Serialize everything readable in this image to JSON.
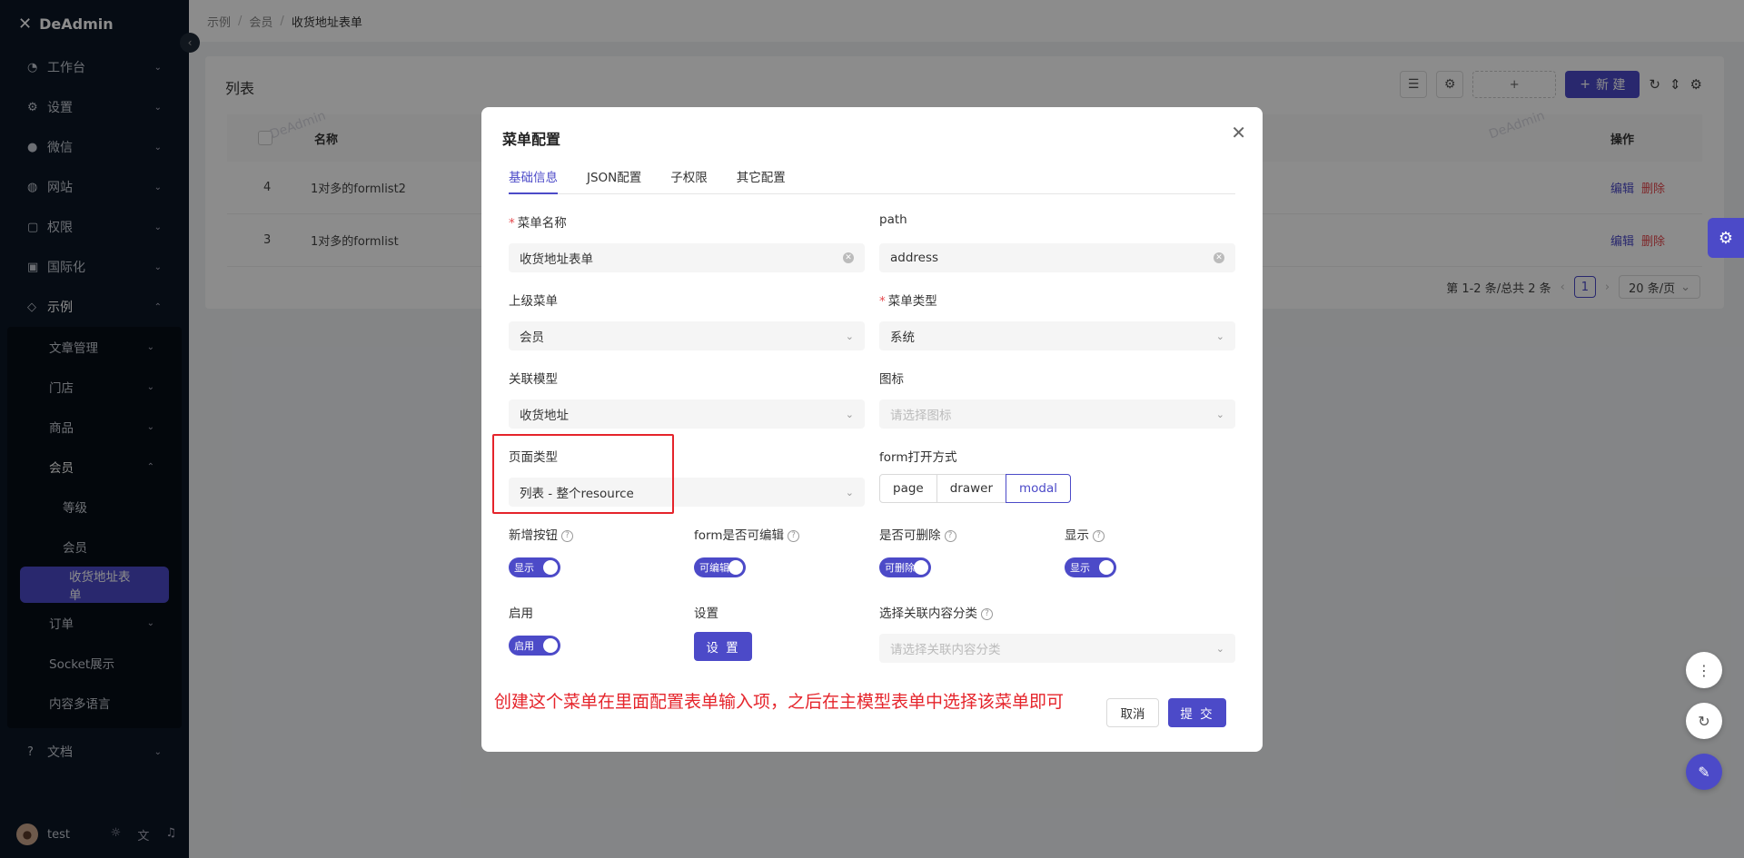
{
  "sidebar": {
    "brand": "DeAdmin",
    "items": [
      {
        "label": "工作台",
        "icon": "dashboard-icon"
      },
      {
        "label": "设置",
        "icon": "gear-icon"
      },
      {
        "label": "微信",
        "icon": "wechat-icon"
      },
      {
        "label": "网站",
        "icon": "globe-icon"
      },
      {
        "label": "权限",
        "icon": "lock-icon"
      },
      {
        "label": "国际化",
        "icon": "translate-icon"
      },
      {
        "label": "示例",
        "icon": "tag-icon"
      }
    ],
    "example_children": [
      {
        "label": "文章管理"
      },
      {
        "label": "门店"
      },
      {
        "label": "商品"
      },
      {
        "label": "会员"
      }
    ],
    "member_children": [
      {
        "label": "等级"
      },
      {
        "label": "会员"
      },
      {
        "label": "收货地址表单"
      }
    ],
    "example_children_after": [
      {
        "label": "订单"
      },
      {
        "label": "Socket展示"
      },
      {
        "label": "内容多语言"
      }
    ],
    "docs": {
      "label": "文档"
    },
    "user": "test"
  },
  "breadcrumb": [
    "示例",
    "会员",
    "收货地址表单"
  ],
  "list": {
    "title": "列表",
    "new_label": "新 建",
    "add_label": "+",
    "columns": {
      "name": "名称",
      "op": "操作"
    },
    "rows": [
      {
        "id": "4",
        "name": "1对多的formlist2",
        "edit": "编辑",
        "delete": "删除"
      },
      {
        "id": "3",
        "name": "1对多的formlist",
        "edit": "编辑",
        "delete": "删除"
      }
    ],
    "pager": {
      "summary": "第 1-2 条/总共 2 条",
      "page": "1",
      "size": "20 条/页"
    },
    "watermark": "DeAdmin"
  },
  "modal": {
    "title": "菜单配置",
    "tabs": [
      "基础信息",
      "JSON配置",
      "子权限",
      "其它配置"
    ],
    "fields": {
      "menu_name": {
        "label": "菜单名称",
        "value": "收货地址表单"
      },
      "path": {
        "label": "path",
        "value": "address"
      },
      "parent": {
        "label": "上级菜单",
        "value": "会员"
      },
      "menu_type": {
        "label": "菜单类型",
        "value": "系统"
      },
      "model": {
        "label": "关联模型",
        "value": "收货地址"
      },
      "icon": {
        "label": "图标",
        "placeholder": "请选择图标"
      },
      "page_type": {
        "label": "页面类型",
        "value": "列表 - 整个resource"
      },
      "form_open": {
        "label": "form打开方式",
        "options": [
          "page",
          "drawer",
          "modal"
        ],
        "selected": "modal"
      },
      "add_btn": {
        "label": "新增按钮",
        "switch": "显示"
      },
      "form_edit": {
        "label": "form是否可编辑",
        "switch": "可编辑"
      },
      "deletable": {
        "label": "是否可删除",
        "switch": "可删除"
      },
      "show": {
        "label": "显示",
        "switch": "显示"
      },
      "enable": {
        "label": "启用",
        "switch": "启用"
      },
      "settings": {
        "label": "设置",
        "button": "设 置"
      },
      "content_cat": {
        "label": "选择关联内容分类",
        "placeholder": "请选择关联内容分类"
      }
    },
    "annotation": "创建这个菜单在里面配置表单输入项，之后在主模型表单中选择该菜单即可",
    "cancel": "取消",
    "submit": "提 交"
  },
  "colors": {
    "accent": "#4c4ac8",
    "danger": "#e5242b",
    "sidebar": "#0b1726"
  }
}
